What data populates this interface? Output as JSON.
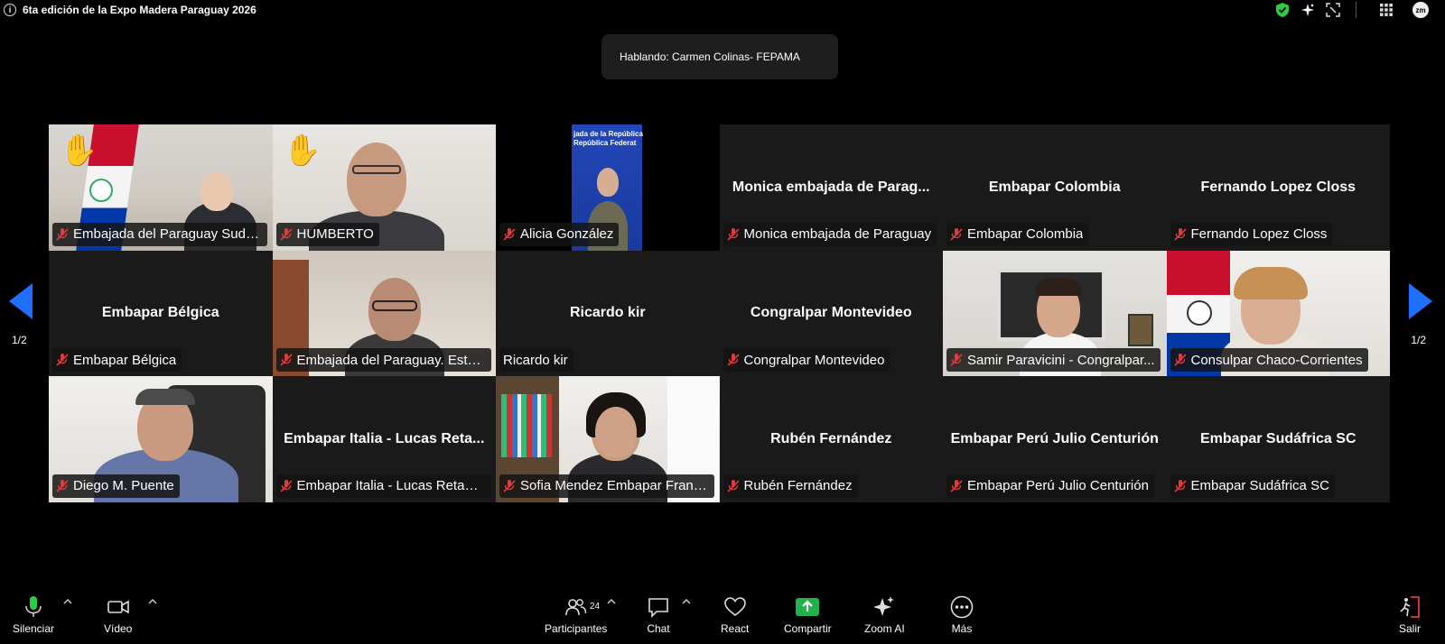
{
  "window": {
    "title": "6ta edición de la Expo Madera Paraguay 2026",
    "avatar_initials": "zm"
  },
  "speaking": {
    "text": "Hablando: Carmen Colinas- FEPAMA"
  },
  "tiles": [
    {
      "name": "Embajada del Paraguay Sudá...",
      "label": "Embajada del Paraguay Sudá...",
      "hand": true,
      "video": true
    },
    {
      "name": "HUMBERTO",
      "label": "HUMBERTO",
      "hand": true,
      "video": true
    },
    {
      "name": "Alicia González",
      "label": "Alicia González",
      "hand": false,
      "video": true
    },
    {
      "name": "Monica embajada de Parag...",
      "label": "Monica embajada de Paraguay",
      "hand": false,
      "video": false
    },
    {
      "name": "Embapar Colombia",
      "label": "Embapar Colombia",
      "hand": false,
      "video": false
    },
    {
      "name": "Fernando Lopez Closs",
      "label": "Fernando Lopez Closs",
      "hand": false,
      "video": false
    },
    {
      "name": "Embapar Bélgica",
      "label": "Embapar Bélgica",
      "hand": false,
      "video": false
    },
    {
      "name": "Embajada del Paraguay. Estel...",
      "label": "Embajada del Paraguay. Estel...",
      "hand": false,
      "video": true
    },
    {
      "name": "Ricardo kir",
      "label": "Ricardo kir",
      "hand": false,
      "video": false
    },
    {
      "name": "Congralpar Montevideo",
      "label": "Congralpar Montevideo",
      "hand": false,
      "video": false
    },
    {
      "name": "Samir Paravicini - Congralpar...",
      "label": "Samir Paravicini - Congralpar...",
      "hand": false,
      "video": true
    },
    {
      "name": "Consulpar Chaco-Corrientes",
      "label": "Consulpar Chaco-Corrientes",
      "hand": false,
      "video": true
    },
    {
      "name": "Diego M. Puente",
      "label": "Diego M. Puente",
      "hand": false,
      "video": true
    },
    {
      "name": "Embapar Italia - Lucas Reta...",
      "label": "Embapar Italia - Lucas Retam...",
      "hand": false,
      "video": false
    },
    {
      "name": "Sofia Mendez Embapar Francia",
      "label": "Sofia Mendez Embapar Francia",
      "hand": false,
      "video": true
    },
    {
      "name": "Rubén Fernández",
      "label": "Rubén Fernández",
      "hand": false,
      "video": false
    },
    {
      "name": "Embapar Perú Julio Centurión",
      "label": "Embapar Perú Julio Centurión",
      "hand": false,
      "video": false
    },
    {
      "name": "Embapar Sudáfrica SC",
      "label": "Embapar Sudáfrica SC",
      "hand": false,
      "video": false
    }
  ],
  "embassy_banner": "jada de la República\nRepública Federat",
  "pagination": {
    "left": "1/2",
    "right": "1/2"
  },
  "toolbar": {
    "mute_label": "Silenciar",
    "video_label": "Vídeo",
    "participants_label": "Participantes",
    "participants_count": "24",
    "chat_label": "Chat",
    "react_label": "React",
    "share_label": "Compartir",
    "ai_label": "Zoom AI",
    "more_label": "Más",
    "leave_label": "Salir"
  },
  "colors": {
    "accent_blue": "#1f6fff",
    "share_green": "#22b14c",
    "mic_green": "#2ecc40",
    "mute_red": "#e03b3b",
    "shield_green": "#2ecc40"
  }
}
